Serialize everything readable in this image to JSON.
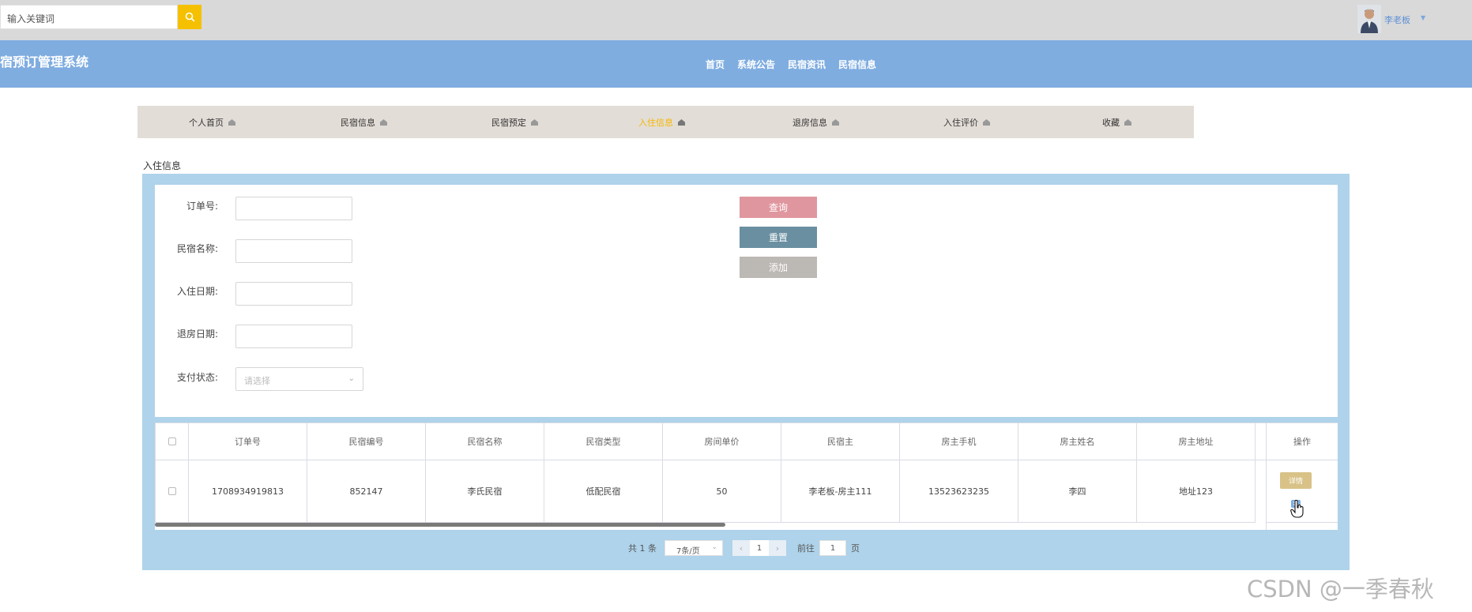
{
  "topbar": {
    "search_placeholder": "输入关键词",
    "username": "李老板"
  },
  "header": {
    "site_title": "民宿预订管理系统",
    "nav": [
      "首页",
      "系统公告",
      "民宿资讯",
      "民宿信息"
    ]
  },
  "subnav": {
    "items": [
      "个人首页",
      "民宿信息",
      "民宿预定",
      "入住信息",
      "退房信息",
      "入住评价",
      "收藏"
    ],
    "active_index": 3
  },
  "page": {
    "section_title": "入住信息"
  },
  "form": {
    "order_no_label": "订单号:",
    "homestay_name_label": "民宿名称:",
    "checkin_date_label": "入住日期:",
    "checkout_date_label": "退房日期:",
    "pay_status_label": "支付状态:",
    "pay_status_placeholder": "请选择",
    "query_button": "查询",
    "reset_button": "重置",
    "add_button": "添加"
  },
  "table": {
    "columns": [
      "订单号",
      "民宿编号",
      "民宿名称",
      "民宿类型",
      "房间单价",
      "民宿主",
      "房主手机",
      "房主姓名",
      "房主地址",
      "操作"
    ],
    "rows": [
      [
        "1708934919813",
        "852147",
        "李氏民宿",
        "低配民宿",
        "50",
        "李老板-房主111",
        "13523623235",
        "李四",
        "地址123"
      ]
    ],
    "detail_button": "详情"
  },
  "pagination": {
    "total_text": "共 1 条",
    "page_size": "7条/页",
    "current_page": "1",
    "goto_prefix": "前往",
    "goto_value": "1",
    "goto_suffix": "页"
  },
  "watermark": "CSDN @一季春秋",
  "colors": {
    "accent": "#f5c000",
    "banner": "#7fade0",
    "panel": "#aed3ea",
    "query": "#e0969e",
    "reset": "#6a8fa1",
    "add": "#bcb8b4"
  }
}
